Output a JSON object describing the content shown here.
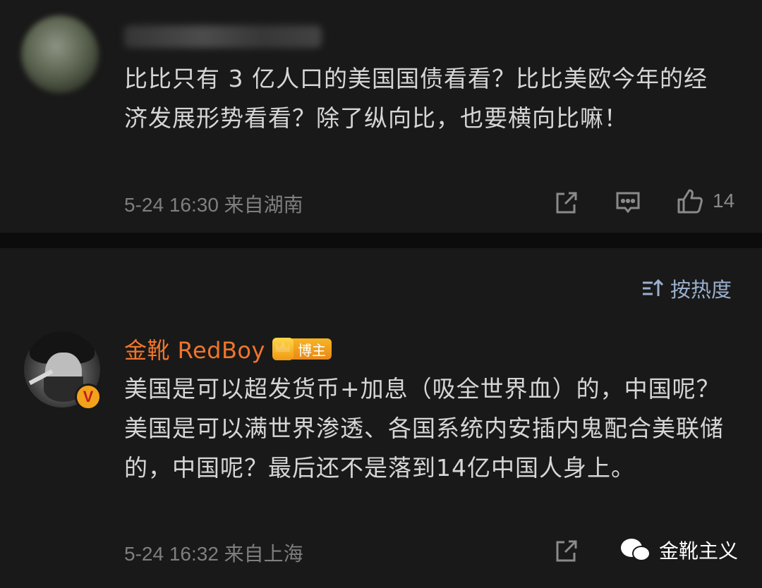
{
  "comment1": {
    "text": "比比只有 3 亿人口的美国国债看看？比比美欧今年的经济发展形势看看？除了纵向比，也要横向比嘛！",
    "meta": "5-24 16:30 来自湖南",
    "like_count": "14"
  },
  "sort": {
    "label": "按热度"
  },
  "comment2": {
    "author": "金靴 RedBoy",
    "badge_label": "博主",
    "verified_mark": "V",
    "text": "美国是可以超发货币+加息（吸全世界血）的，中国呢？美国是可以满世界渗透、各国系统内安插内鬼配合美联储的，中国呢？最后还不是落到14亿中国人身上。",
    "meta": "5-24 16:32 来自上海"
  },
  "watermark": {
    "label": "金靴主义"
  },
  "colors": {
    "author": "#f0752b",
    "sort": "#9ab0cf",
    "badge": "#f3a21b"
  }
}
